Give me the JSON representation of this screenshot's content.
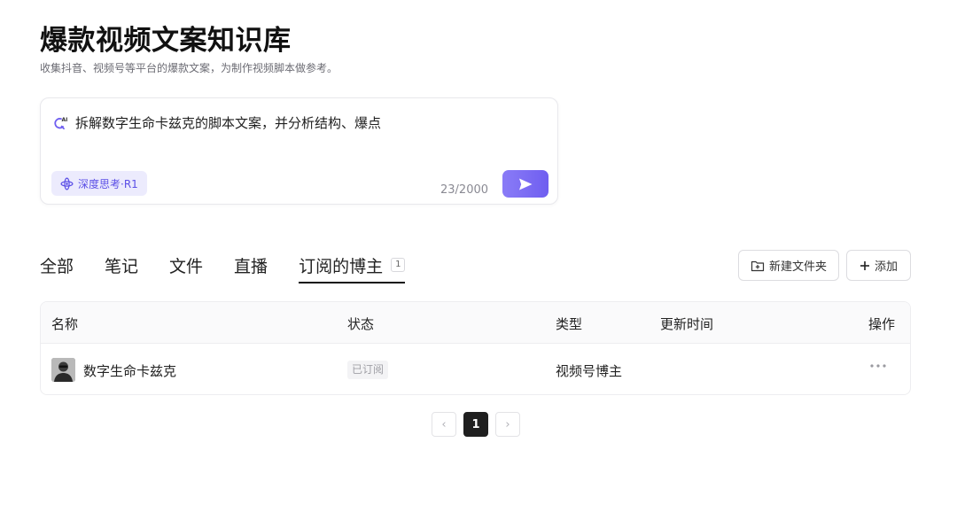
{
  "header": {
    "title": "爆款视频文案知识库",
    "subtitle": "收集抖音、视频号等平台的爆款文案，为制作视频脚本做参考。"
  },
  "ask_box": {
    "query": "拆解数字生命卡兹克的脚本文案，并分析结构、爆点",
    "deep_think_label": "深度思考·R1",
    "char_count": "23/2000",
    "ai_icon_text": "AI",
    "accent_color": "#6f5ef0"
  },
  "tabs": [
    {
      "label": "全部",
      "active": false
    },
    {
      "label": "笔记",
      "active": false
    },
    {
      "label": "文件",
      "active": false
    },
    {
      "label": "直播",
      "active": false
    },
    {
      "label": "订阅的博主",
      "active": true,
      "badge": "1"
    }
  ],
  "actions": {
    "new_folder_label": "新建文件夹",
    "add_label": "添加"
  },
  "table": {
    "columns": [
      "名称",
      "状态",
      "类型",
      "更新时间",
      "操作"
    ],
    "rows": [
      {
        "name": "数字生命卡兹克",
        "status": "已订阅",
        "type": "视频号博主",
        "updated": ""
      }
    ]
  },
  "pagination": {
    "prev": "‹",
    "current": "1",
    "next": "›"
  }
}
